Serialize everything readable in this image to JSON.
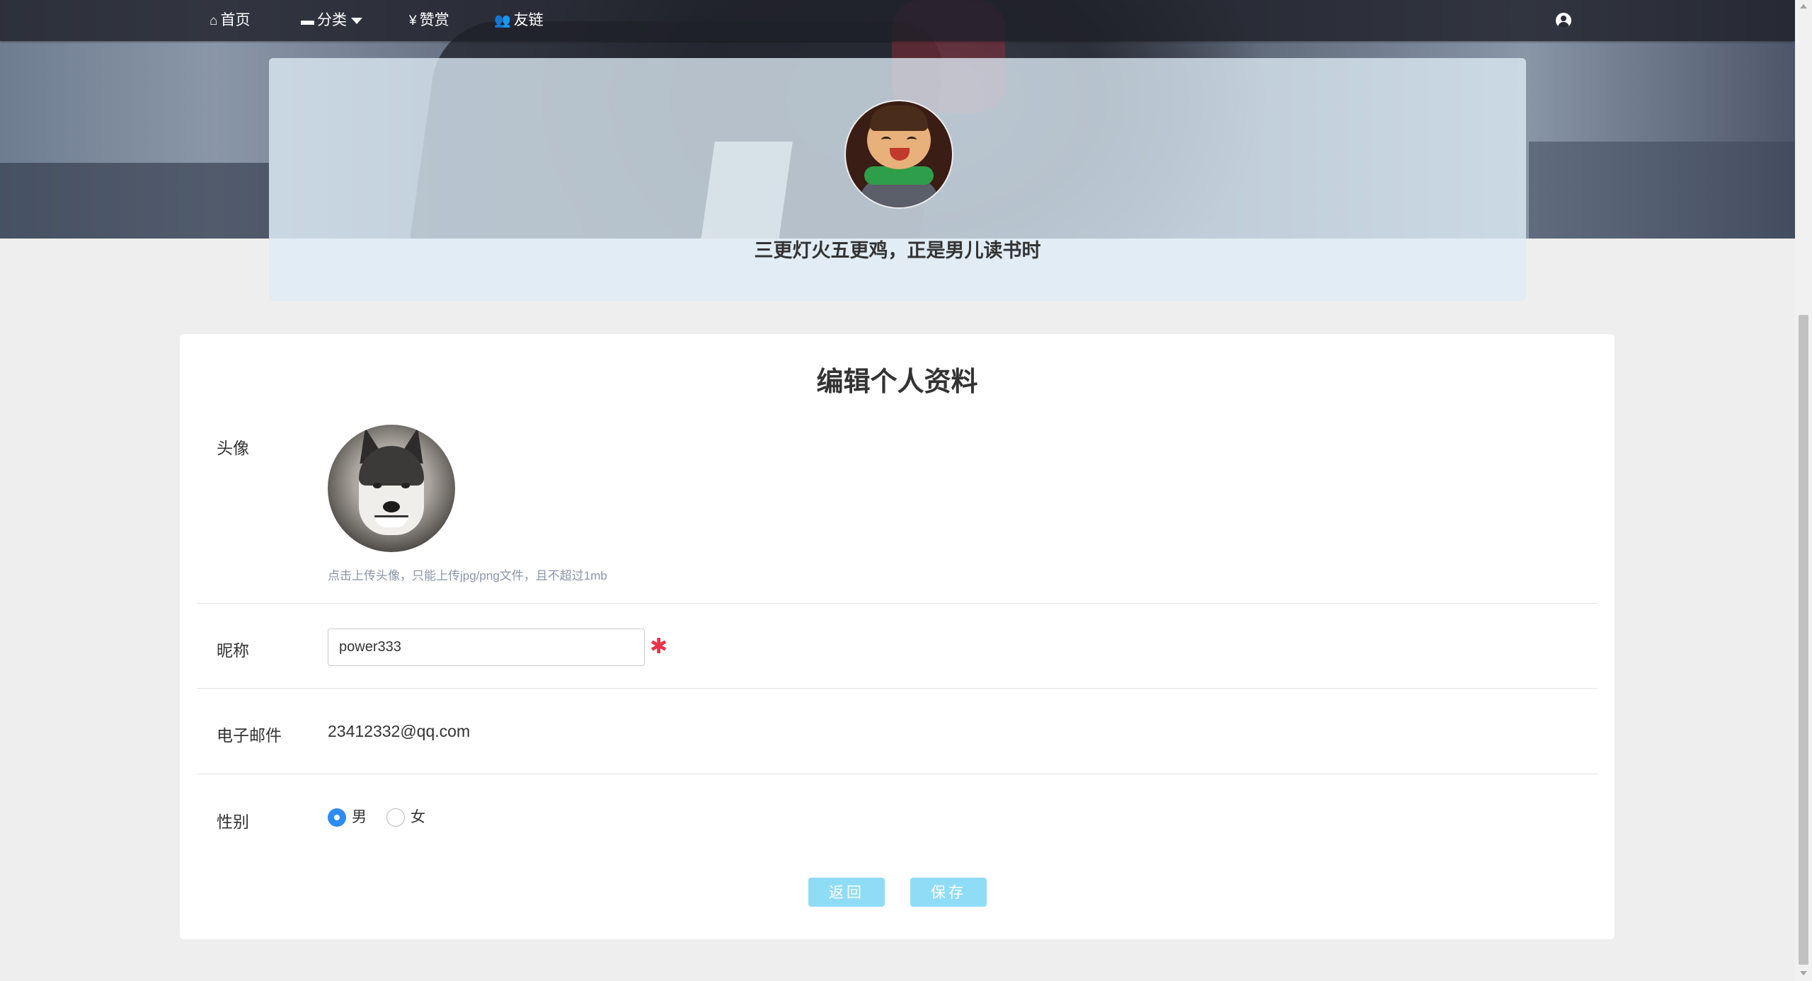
{
  "nav": {
    "home": "首页",
    "category": "分类",
    "reward": "赞赏",
    "friends": "友链",
    "icons": {
      "home": "home-icon",
      "category": "archive-icon",
      "reward": "yen-icon",
      "friends": "users-icon",
      "user": "user-circle-icon"
    }
  },
  "banner": {
    "motto": "三更灯火五更鸡，正是男儿读书时"
  },
  "form": {
    "title": "编辑个人资料",
    "avatar_label": "头像",
    "avatar_hint": "点击上传头像，只能上传jpg/png文件，且不超过1mb",
    "nickname_label": "昵称",
    "nickname_value": "power333",
    "required_mark": "✱",
    "email_label": "电子邮件",
    "email_value": "23412332@qq.com",
    "gender_label": "性别",
    "gender_options": [
      "男",
      "女"
    ],
    "gender_selected": "男",
    "back_button": "返回",
    "save_button": "保存"
  },
  "colors": {
    "accent": "#2d8cf0",
    "button": "#8fdcf7",
    "required": "#e8334a"
  }
}
